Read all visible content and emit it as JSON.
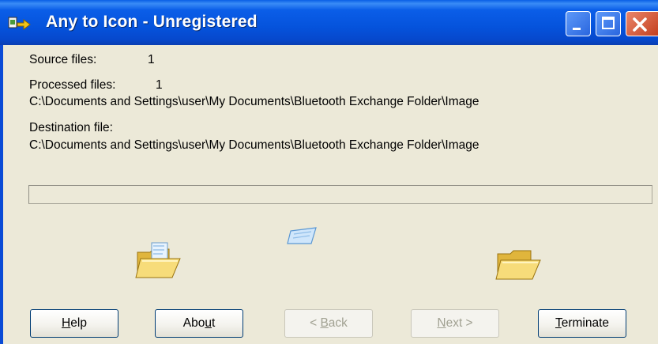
{
  "window": {
    "title": "Any to Icon - Unregistered"
  },
  "titlebar_buttons": {
    "minimize_icon": "minimize-icon",
    "maximize_icon": "maximize-icon",
    "close_icon": "close-icon"
  },
  "info": {
    "source_label": "Source files:",
    "source_count": "1",
    "processed_label": "Processed files:",
    "processed_count": "1",
    "processed_path": "C:\\Documents and Settings\\user\\My Documents\\Bluetooth Exchange Folder\\Image",
    "destination_label": "Destination file:",
    "destination_path": "C:\\Documents and Settings\\user\\My Documents\\Bluetooth Exchange Folder\\Image"
  },
  "progress": {
    "value": 0
  },
  "animation": {
    "source_icon": "open-folder-with-file-icon",
    "flying_icon": "flying-file-icon",
    "dest_icon": "open-folder-icon"
  },
  "buttons": {
    "help": {
      "pre": "",
      "mnemonic": "H",
      "post": "elp",
      "enabled": true
    },
    "about": {
      "pre": "Abo",
      "mnemonic": "u",
      "post": "t",
      "enabled": true
    },
    "back": {
      "pre": "< ",
      "mnemonic": "B",
      "post": "ack",
      "enabled": false
    },
    "next": {
      "pre": "",
      "mnemonic": "N",
      "post": "ext >",
      "enabled": false
    },
    "terminate": {
      "pre": "",
      "mnemonic": "T",
      "post": "erminate",
      "enabled": true
    }
  },
  "colors": {
    "titlebar": "#0553dc",
    "dialog_bg": "#ece9d8",
    "close_button": "#c5401f",
    "disabled_text": "#a1a192"
  }
}
